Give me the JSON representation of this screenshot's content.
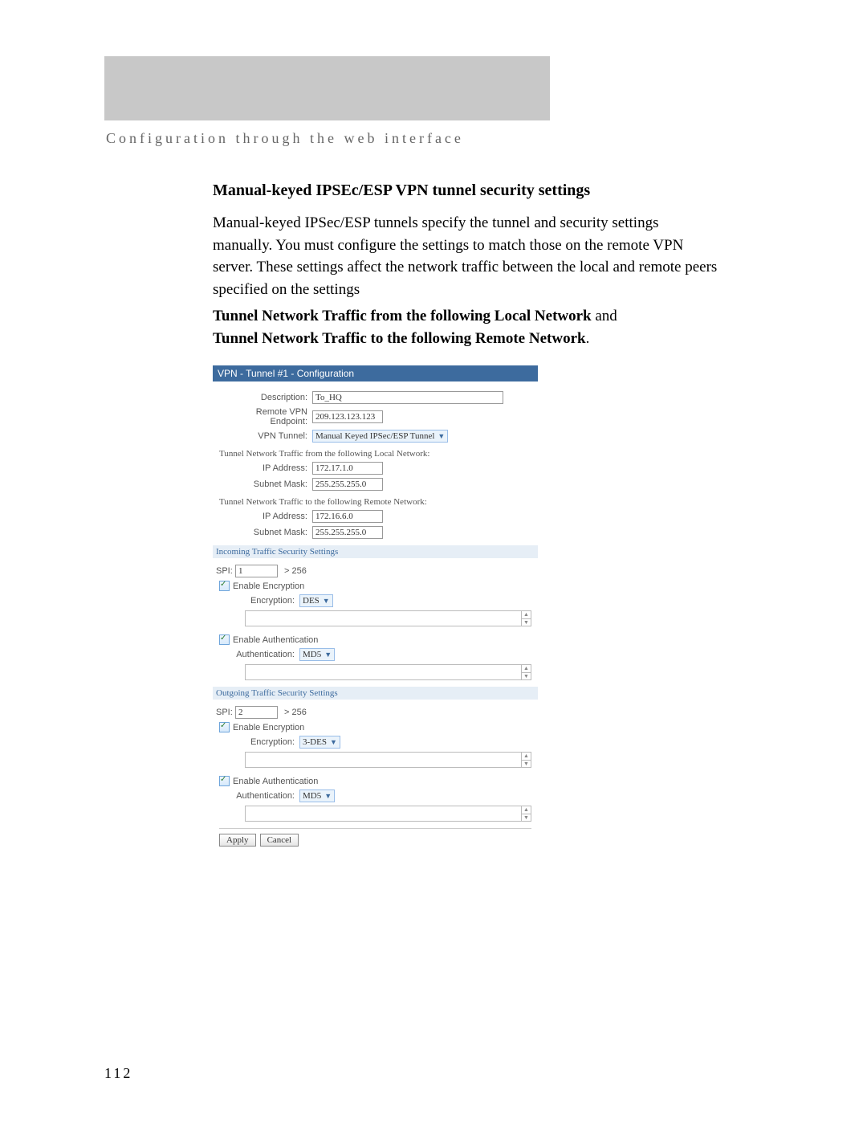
{
  "chapter_title": "Configuration through the web interface",
  "article": {
    "heading": "Manual-keyed IPSEc/ESP VPN tunnel security settings",
    "para": "Manual-keyed IPSec/ESP tunnels specify the tunnel and security settings manually. You must configure the settings to match those on the remote VPN server. These settings affect the network traffic between the local and remote peers specified on the settings",
    "bold1": "Tunnel Network Traffic from the following Local Network",
    "and": " and",
    "bold2": "Tunnel Network Traffic to the following Remote Network",
    "period": "."
  },
  "panel": {
    "title": "VPN - Tunnel #1 - Configuration",
    "labels": {
      "description": "Description:",
      "remote_endpoint": "Remote VPN Endpoint:",
      "vpn_tunnel": "VPN Tunnel:",
      "ip_address": "IP Address:",
      "subnet_mask": "Subnet Mask:",
      "spi": "SPI:",
      "spi_hint": "> 256",
      "enable_encryption": "Enable Encryption",
      "encryption": "Encryption:",
      "enable_auth": "Enable Authentication",
      "authentication": "Authentication:"
    },
    "values": {
      "description": "To_HQ",
      "remote_endpoint": "209.123.123.123",
      "vpn_tunnel_select": "Manual Keyed IPSec/ESP Tunnel",
      "local_ip": "172.17.1.0",
      "local_mask": "255.255.255.0",
      "remote_ip": "172.16.6.0",
      "remote_mask": "255.255.255.0",
      "in_spi": "1",
      "out_spi": "2",
      "enc_des": "DES",
      "enc_3des": "3-DES",
      "auth_md5": "MD5"
    },
    "sections": {
      "local": "Tunnel Network Traffic from the following Local Network:",
      "remote": "Tunnel Network Traffic to the following Remote Network:",
      "incoming": "Incoming Traffic Security Settings",
      "outgoing": "Outgoing Traffic Security Settings"
    },
    "buttons": {
      "apply": "Apply",
      "cancel": "Cancel"
    }
  },
  "page_number": "112"
}
